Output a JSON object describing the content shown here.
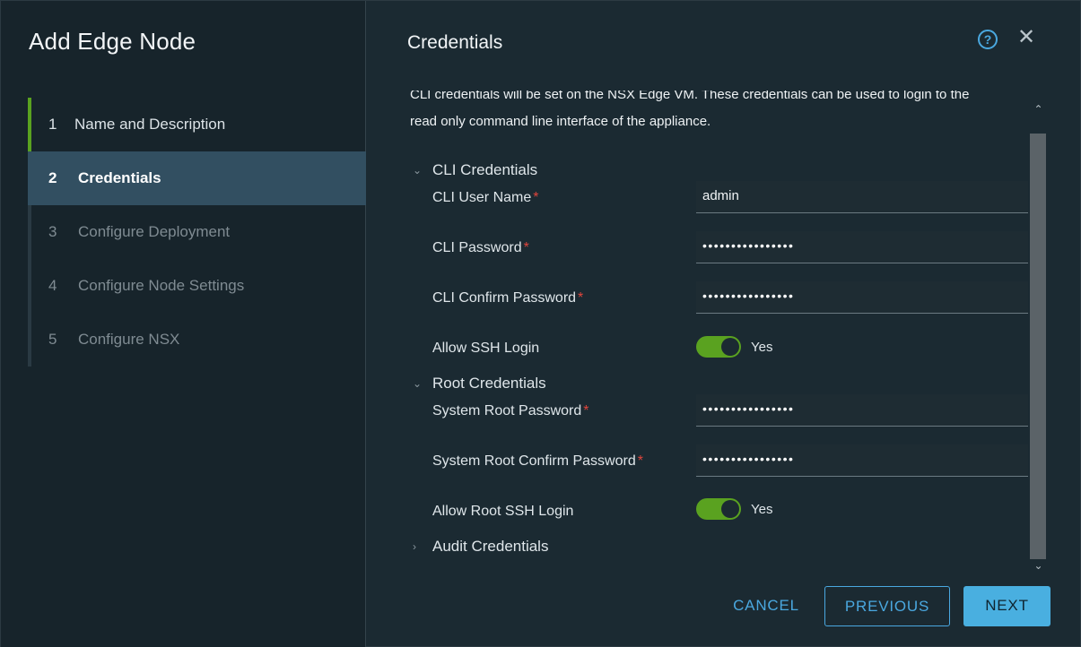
{
  "wizard": {
    "title": "Add Edge Node",
    "steps": [
      {
        "num": "1",
        "label": "Name and Description",
        "state": "done"
      },
      {
        "num": "2",
        "label": "Credentials",
        "state": "active"
      },
      {
        "num": "3",
        "label": "Configure Deployment",
        "state": "pending"
      },
      {
        "num": "4",
        "label": "Configure Node Settings",
        "state": "pending"
      },
      {
        "num": "5",
        "label": "Configure NSX",
        "state": "pending"
      }
    ]
  },
  "page": {
    "title": "Credentials",
    "intro_line1": "CLI credentials will be set on the NSX Edge VM. These credentials can be used to login to the",
    "intro_line2": "read only command line interface of the appliance."
  },
  "icons": {
    "help": "help-circle-icon",
    "close": "close-icon"
  },
  "cli": {
    "section_label": "CLI Credentials",
    "username_label": "CLI User Name",
    "username_value": "admin",
    "password_label": "CLI Password",
    "password_value": "••••••••••••••••",
    "confirm_label": "CLI Confirm Password",
    "confirm_value": "••••••••••••••••",
    "ssh_label": "Allow SSH Login",
    "ssh_value": "Yes"
  },
  "root": {
    "section_label": "Root Credentials",
    "password_label": "System Root Password",
    "password_value": "••••••••••••••••",
    "confirm_label": "System Root Confirm Password",
    "confirm_value": "••••••••••••••••",
    "ssh_label": "Allow Root SSH Login",
    "ssh_value": "Yes"
  },
  "audit": {
    "section_label": "Audit Credentials"
  },
  "required_mark": "*",
  "footer": {
    "cancel": "CANCEL",
    "previous": "PREVIOUS",
    "next": "NEXT"
  },
  "colors": {
    "accent": "#49afe0",
    "toggle_on": "#5aa220",
    "required": "#e0453c",
    "active_step_bg": "#324f61"
  }
}
